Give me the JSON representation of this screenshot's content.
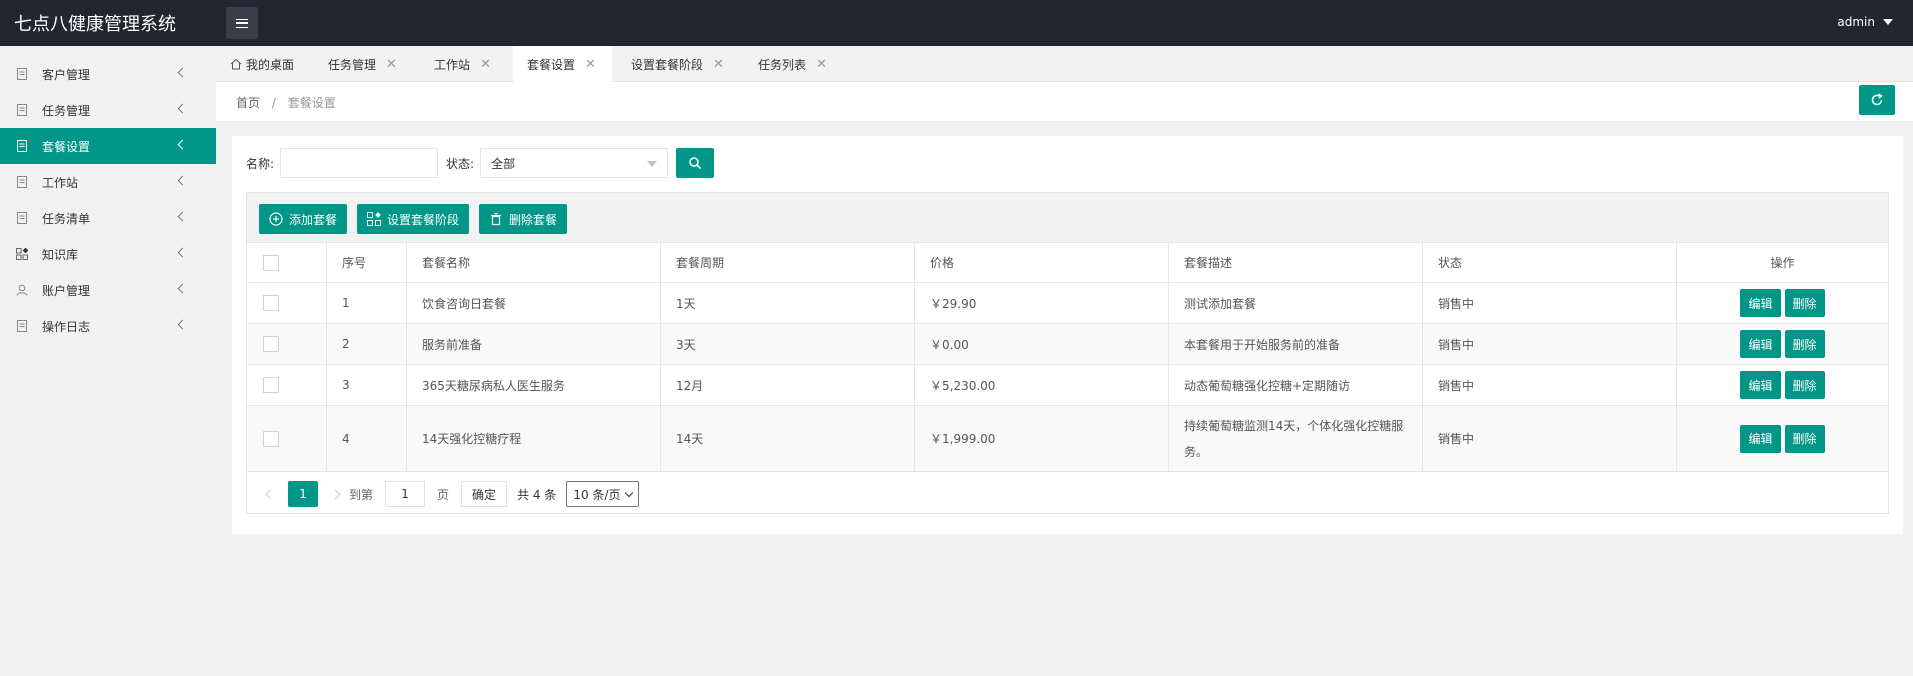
{
  "app": {
    "title": "七点八健康管理系统",
    "user": "admin"
  },
  "sidebar": {
    "items": [
      {
        "label": "客户管理",
        "icon": "doc-icon"
      },
      {
        "label": "任务管理",
        "icon": "doc-icon"
      },
      {
        "label": "套餐设置",
        "icon": "doc-icon",
        "active": true
      },
      {
        "label": "工作站",
        "icon": "doc-icon"
      },
      {
        "label": "任务清单",
        "icon": "doc-icon"
      },
      {
        "label": "知识库",
        "icon": "apps-icon"
      },
      {
        "label": "账户管理",
        "icon": "user-icon"
      },
      {
        "label": "操作日志",
        "icon": "doc-icon"
      }
    ]
  },
  "tabs": [
    {
      "label": "我的桌面"
    },
    {
      "label": "任务管理"
    },
    {
      "label": "工作站"
    },
    {
      "label": "套餐设置",
      "active": true
    },
    {
      "label": "设置套餐阶段"
    },
    {
      "label": "任务列表"
    }
  ],
  "breadcrumb": {
    "home": "首页",
    "sep": "/",
    "current": "套餐设置"
  },
  "search": {
    "name_label": "名称:",
    "name_value": "",
    "status_label": "状态:",
    "status_value": "全部"
  },
  "toolbar": {
    "add": "添加套餐",
    "set_stage": "设置套餐阶段",
    "delete": "删除套餐"
  },
  "table": {
    "columns": [
      "",
      "序号",
      "套餐名称",
      "套餐周期",
      "价格",
      "套餐描述",
      "状态",
      "操作"
    ],
    "rows": [
      {
        "no": "1",
        "name": "饮食咨询日套餐",
        "period": "1天",
        "price": "￥29.90",
        "desc": "测试添加套餐",
        "status": "销售中"
      },
      {
        "no": "2",
        "name": "服务前准备",
        "period": "3天",
        "price": "￥0.00",
        "desc": "本套餐用于开始服务前的准备",
        "status": "销售中"
      },
      {
        "no": "3",
        "name": "365天糖尿病私人医生服务",
        "period": "12月",
        "price": "￥5,230.00",
        "desc": "动态葡萄糖强化控糖+定期随访",
        "status": "销售中"
      },
      {
        "no": "4",
        "name": "14天强化控糖疗程",
        "period": "14天",
        "price": "￥1,999.00",
        "desc": "持续葡萄糖监测14天，个体化强化控糖服务。",
        "status": "销售中"
      }
    ],
    "edit_label": "编辑",
    "delete_label": "删除"
  },
  "pager": {
    "current": "1",
    "goto_prefix": "到第",
    "goto_value": "1",
    "goto_suffix": "页",
    "confirm": "确定",
    "total": "共 4 条",
    "page_size": "10 条/页"
  },
  "colors": {
    "accent": "#009688",
    "header": "#23262e"
  }
}
